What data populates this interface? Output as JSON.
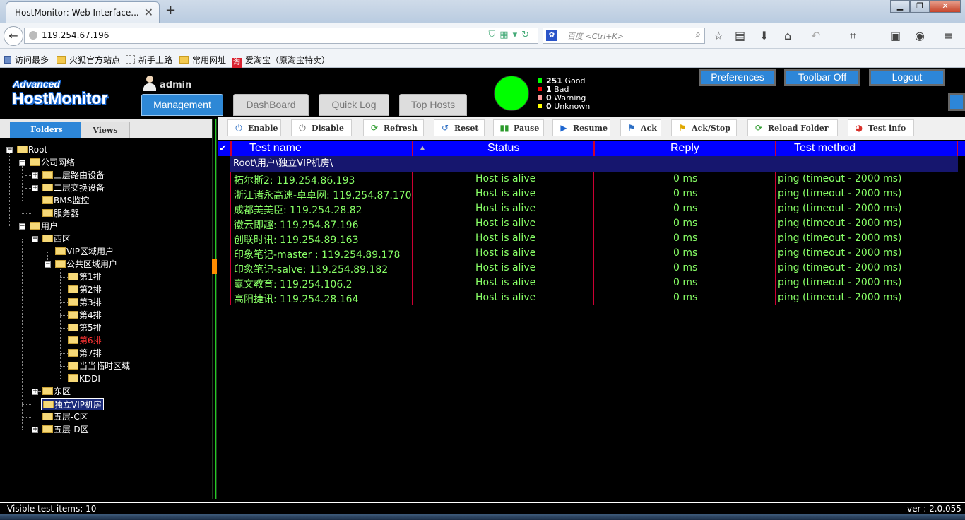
{
  "browser": {
    "tab_title": "HostMonitor: Web Interface...",
    "tab_close": "✕",
    "new_tab": "+",
    "url": "119.254.67.196",
    "search_placeholder": "百度 <Ctrl+K>",
    "window_controls": [
      "▁",
      "❐",
      "✕"
    ]
  },
  "bookmarks": [
    {
      "label": "访问最多",
      "icon": "bookmark-icon"
    },
    {
      "label": "火狐官方站点",
      "icon": "folder-icon"
    },
    {
      "label": "新手上路",
      "icon": "dashed-folder-icon"
    },
    {
      "label": "常用网址",
      "icon": "folder-icon"
    },
    {
      "label": "爱淘宝（原淘宝特卖）",
      "icon": "taobao-icon"
    }
  ],
  "app": {
    "logo_top": "Advanced",
    "logo_bottom": "HostMonitor",
    "user": "admin",
    "tabs": [
      "Management",
      "DashBoard",
      "Quick Log",
      "Top Hosts"
    ],
    "buttons": [
      "Preferences",
      "Toolbar Off",
      "Logout"
    ],
    "stats": [
      {
        "count": "251",
        "label": "Good",
        "color": "#00ff00"
      },
      {
        "count": "1",
        "label": "Bad",
        "color": "#ff0000"
      },
      {
        "count": "0",
        "label": "Warning",
        "color": "#ff9999"
      },
      {
        "count": "0",
        "label": "Unknown",
        "color": "#ffff00"
      }
    ]
  },
  "left": {
    "tabs": [
      "Folders",
      "Views"
    ],
    "tree": [
      "Root",
      "公司网络",
      "三层路由设备",
      "二层交换设备",
      "BMS监控",
      "服务器",
      "用户",
      "西区",
      "VIP区域用户",
      "公共区域用户",
      "第1排",
      "第2排",
      "第3排",
      "第4排",
      "第5排",
      "第6排",
      "第7排",
      "当当临时区域",
      "KDDI",
      "东区",
      "独立VIP机房",
      "五层-C区",
      "五层-D区"
    ]
  },
  "toolbar": [
    "Enable",
    "Disable",
    "Refresh",
    "Reset",
    "Pause",
    "Resume",
    "Ack",
    "Ack/Stop",
    "Reload Folder",
    "Test info"
  ],
  "grid": {
    "columns": [
      "Test name",
      "Status",
      "Reply",
      "Test method"
    ],
    "path": "Root\\用户\\独立VIP机房\\",
    "rows": [
      [
        "拓尔斯2: 119.254.86.193",
        "Host is alive",
        "0 ms",
        "ping (timeout - 2000 ms)"
      ],
      [
        "浙江诸永高速-卓卓网: 119.254.87.170",
        "Host is alive",
        "0 ms",
        "ping (timeout - 2000 ms)"
      ],
      [
        "成都美美臣: 119.254.28.82",
        "Host is alive",
        "0 ms",
        "ping (timeout - 2000 ms)"
      ],
      [
        "徽云即趣: 119.254.87.196",
        "Host is alive",
        "0 ms",
        "ping (timeout - 2000 ms)"
      ],
      [
        "创联时讯: 119.254.89.163",
        "Host is alive",
        "0 ms",
        "ping (timeout - 2000 ms)"
      ],
      [
        "印象笔记-master : 119.254.89.178",
        "Host is alive",
        "0 ms",
        "ping (timeout - 2000 ms)"
      ],
      [
        "印象笔记-salve: 119.254.89.182",
        "Host is alive",
        "0 ms",
        "ping (timeout - 2000 ms)"
      ],
      [
        "赢文教育: 119.254.106.2",
        "Host is alive",
        "0 ms",
        "ping (timeout - 2000 ms)"
      ],
      [
        "高阳捷讯: 119.254.28.164",
        "Host is alive",
        "0 ms",
        "ping (timeout - 2000 ms)"
      ]
    ]
  },
  "status": {
    "visible": "Visible test items: 10",
    "version": "ver : 2.0.055"
  },
  "colors": {
    "accent": "#2d86d8",
    "grid_header": "#0000ff",
    "text_ok": "#88ff66",
    "highlight_node": "#ff3333"
  }
}
